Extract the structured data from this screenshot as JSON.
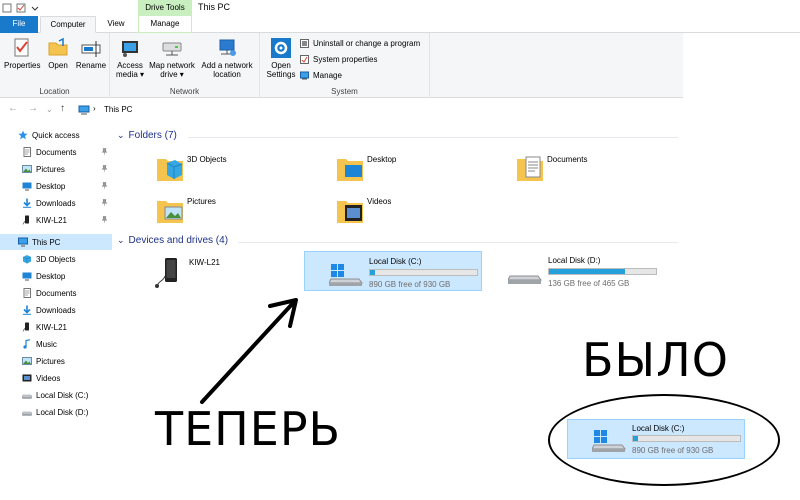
{
  "window": {
    "context_tab": "Drive Tools",
    "title": "This PC"
  },
  "tabs": {
    "file": "File",
    "computer": "Computer",
    "view": "View",
    "manage": "Manage"
  },
  "ribbon": {
    "location": {
      "label": "Location",
      "properties": "Properties",
      "open": "Open",
      "rename": "Rename"
    },
    "network": {
      "label": "Network",
      "access_media": "Access media ▾",
      "map_drive": "Map network drive ▾",
      "add_location": "Add a network location"
    },
    "system": {
      "label": "System",
      "open_settings": "Open Settings",
      "uninstall": "Uninstall or change a program",
      "sys_props": "System properties",
      "manage": "Manage"
    }
  },
  "address": {
    "breadcrumb": "This PC"
  },
  "sidebar": {
    "items": [
      {
        "label": "Quick access",
        "icon": "star-icon",
        "pinned": false
      },
      {
        "label": "Documents",
        "icon": "documents-icon",
        "pinned": true
      },
      {
        "label": "Pictures",
        "icon": "pictures-icon",
        "pinned": true
      },
      {
        "label": "Desktop",
        "icon": "desktop-icon",
        "pinned": true
      },
      {
        "label": "Downloads",
        "icon": "downloads-icon",
        "pinned": true
      },
      {
        "label": "KIW-L21",
        "icon": "phone-icon",
        "pinned": true
      },
      {
        "label": "This PC",
        "icon": "computer-icon",
        "pinned": false
      },
      {
        "label": "3D Objects",
        "icon": "3d-objects-icon",
        "pinned": false
      },
      {
        "label": "Desktop",
        "icon": "desktop-icon",
        "pinned": false
      },
      {
        "label": "Documents",
        "icon": "documents-icon",
        "pinned": false
      },
      {
        "label": "Downloads",
        "icon": "downloads-icon",
        "pinned": false
      },
      {
        "label": "KIW-L21",
        "icon": "phone-icon",
        "pinned": false
      },
      {
        "label": "Music",
        "icon": "music-icon",
        "pinned": false
      },
      {
        "label": "Pictures",
        "icon": "pictures-icon",
        "pinned": false
      },
      {
        "label": "Videos",
        "icon": "videos-icon",
        "pinned": false
      },
      {
        "label": "Local Disk (C:)",
        "icon": "drive-icon",
        "pinned": false
      },
      {
        "label": "Local Disk (D:)",
        "icon": "drive-icon",
        "pinned": false
      }
    ],
    "pin_glyph": "📌"
  },
  "content": {
    "folders_header": "Folders (7)",
    "folders": [
      "3D Objects",
      "Desktop",
      "Documents",
      "Pictures",
      "Videos"
    ],
    "devices_header": "Devices and drives (4)",
    "device_phone": "KIW-L21",
    "drive_c": {
      "name": "Local Disk (C:)",
      "free": "890 GB free of 930 GB",
      "used_fraction": 0.043
    },
    "drive_d": {
      "name": "Local Disk (D:)",
      "free": "136 GB free of 465 GB",
      "used_fraction": 0.708
    }
  },
  "annotations": {
    "now": "ТЕПЕРЬ",
    "was": "БЫЛО",
    "old_drive": {
      "name": "Local Disk (C:)",
      "free": "890 GB free of 930 GB",
      "used_fraction": 0.043
    }
  },
  "colors": {
    "accent": "#1979ca",
    "selection": "#cce8ff",
    "bar_fill": "#26a0da",
    "context_tab": "#c9efc0"
  }
}
